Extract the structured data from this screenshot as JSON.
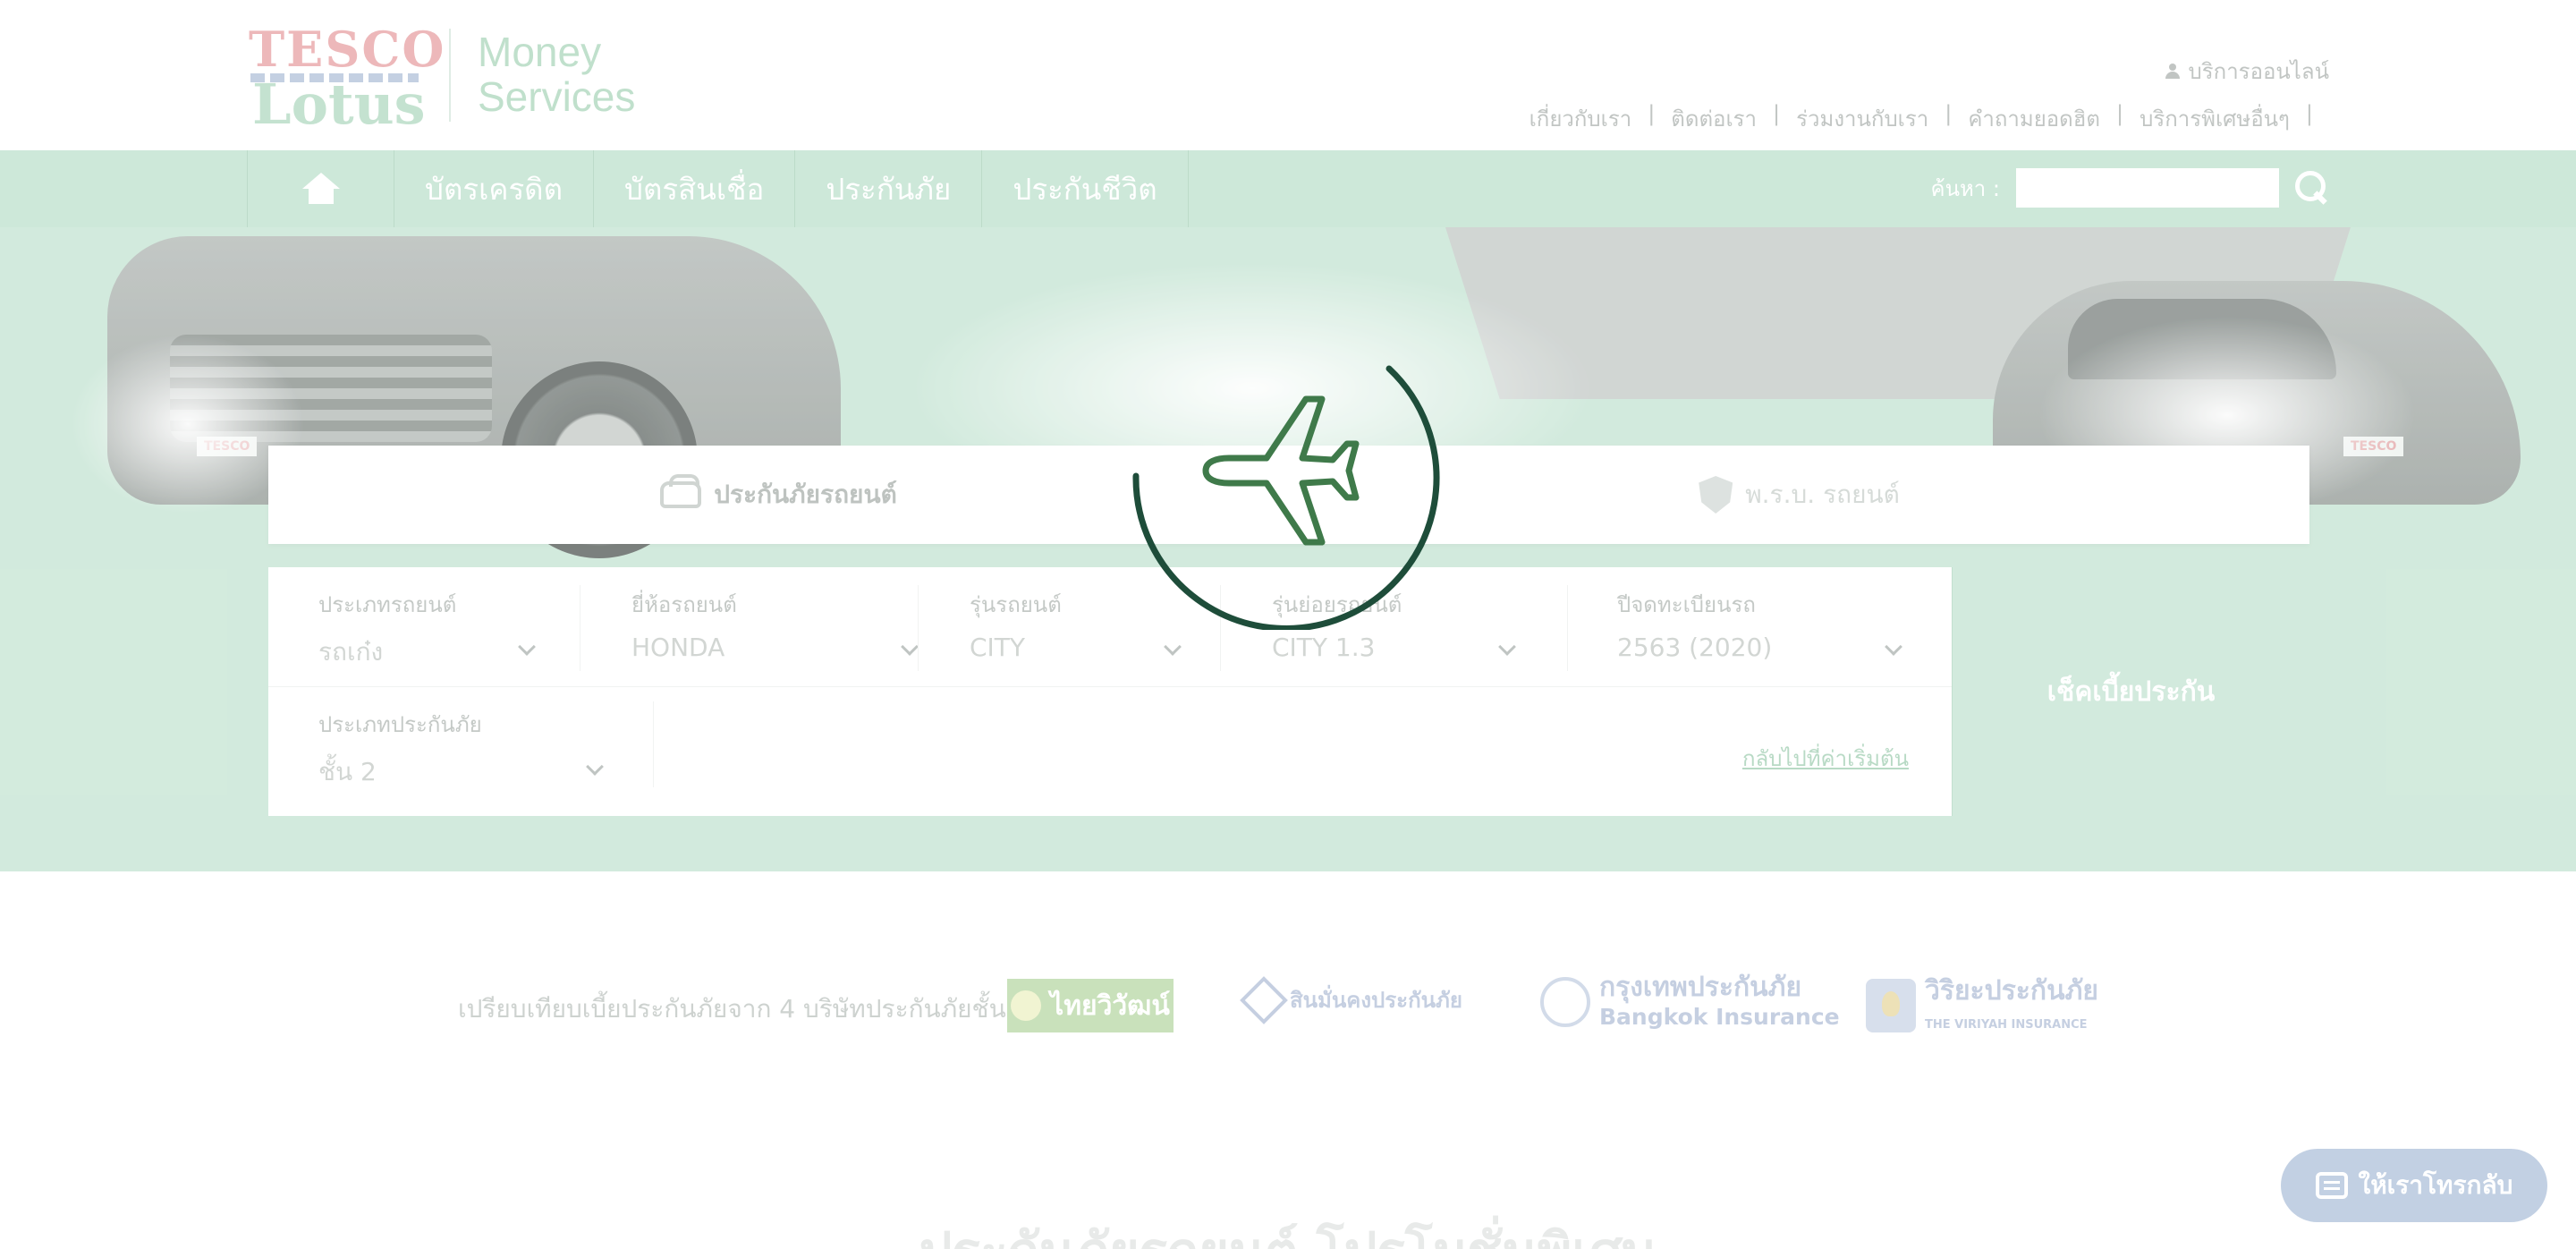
{
  "header": {
    "logo_line1": "TESCO",
    "logo_line2": "Lotus",
    "brand_line1": "Money",
    "brand_line2": "Services",
    "online_service": "บริการออนไลน์",
    "links": [
      "เกี่ยวกับเรา",
      "ติดต่อเรา",
      "ร่วมงานกับเรา",
      "คำถามยอดฮิต",
      "บริการพิเศษอื่นๆ"
    ]
  },
  "nav": {
    "home_icon": "home-icon",
    "items": [
      "บัตรเครดิต",
      "บัตรสินเชื่อ",
      "ประกันภัย",
      "ประกันชีวิต"
    ],
    "search_label": "ค้นหา :",
    "search_placeholder": "",
    "search_icon": "search-icon"
  },
  "tabs": {
    "car_insurance": "ประกันภัยรถยนต์",
    "compulsory": "พ.ร.บ. รถยนต์"
  },
  "form": {
    "car_type": {
      "label": "ประเภทรถยนต์",
      "value": "รถเก๋ง"
    },
    "brand": {
      "label": "ยี่ห้อรถยนต์",
      "value": "HONDA"
    },
    "model": {
      "label": "รุ่นรถยนต์",
      "value": "CITY"
    },
    "submodel": {
      "label": "รุ่นย่อยรถยนต์",
      "value": "CITY 1.3"
    },
    "year": {
      "label": "ปีจดทะเบียนรถ",
      "value": "2563 (2020)"
    },
    "insurance_type": {
      "label": "ประเภทประกันภัย",
      "value": "ชั้น 2"
    },
    "reset_link": "กลับไปที่ค่าเริ่มต้น",
    "check_button": "เช็คเบี้ยประกัน"
  },
  "partners": {
    "text": "เปรียบเทียบเบี้ยประกันภัยจาก 4 บริษัทประกันภัยชั้นนำ",
    "thaivivat": "ไทยวิวัฒน์",
    "sinmunkong": "สินมั่นคงประกันภัย",
    "bangkok_th": "กรุงเทพประกันภัย",
    "bangkok_en": "Bangkok Insurance",
    "viriyah_th": "วิริยะประกันภัย",
    "viriyah_en": "THE VIRIYAH INSURANCE"
  },
  "promo_title": "ประกันภัยรถยนต์ โปรโมชั่นพิเศษ",
  "callback_button": "ให้เราโทรกลับ",
  "colors": {
    "nav_bg": "#c3e3d1",
    "hero_bg": "#c9e6d6",
    "loader_ring": "#1e4d3a",
    "loader_plane": "#3f7a4a"
  },
  "loader_icon": "airplane-icon"
}
